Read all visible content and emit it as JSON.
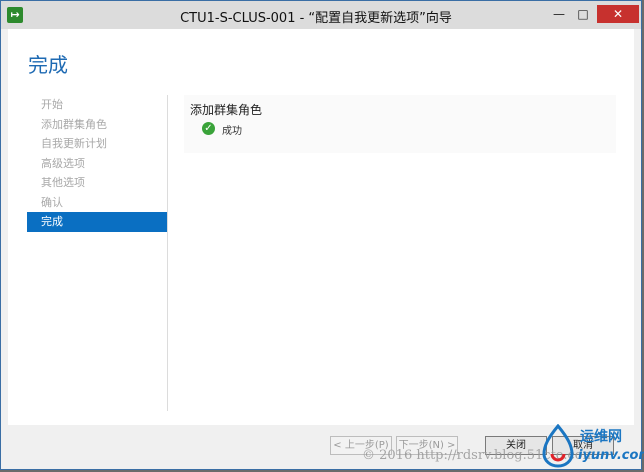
{
  "window": {
    "title": "CTU1-S-CLUS-001 - “配置自我更新选项”向导",
    "app_icon_glyph": "↦",
    "minimize_glyph": "—",
    "maximize_glyph": "□",
    "close_glyph": "✕"
  },
  "page": {
    "title": "完成"
  },
  "nav": {
    "items": [
      {
        "label": "开始",
        "active": false
      },
      {
        "label": "添加群集角色",
        "active": false
      },
      {
        "label": "自我更新计划",
        "active": false
      },
      {
        "label": "高级选项",
        "active": false
      },
      {
        "label": "其他选项",
        "active": false
      },
      {
        "label": "确认",
        "active": false
      },
      {
        "label": "完成",
        "active": true
      }
    ]
  },
  "result": {
    "title": "添加群集角色",
    "status_icon_glyph": "✓",
    "status": "成功"
  },
  "footer": {
    "prev_label": "< 上一步(P)",
    "next_label": "下一步(N) >",
    "close_label": "关闭",
    "cancel_label": "取消"
  },
  "watermark": {
    "text": "© 2016 http://rdsrv.blog.51cto.com",
    "logo_cn": "运维网",
    "logo_en": "iyunv.com"
  },
  "colors": {
    "accent": "#1e6ab3",
    "nav_active_bg": "#0a6fc2",
    "success": "#3aa33a",
    "close_button": "#c7312e"
  }
}
